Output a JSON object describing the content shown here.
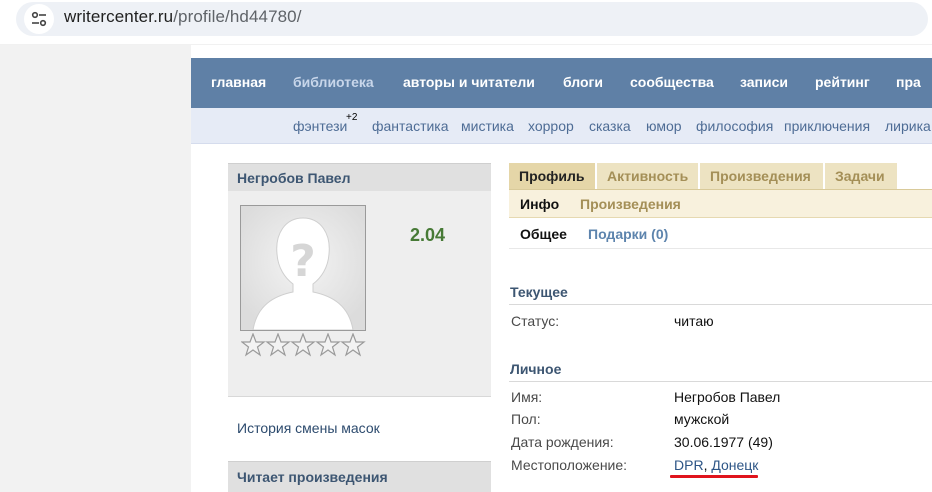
{
  "browser": {
    "url_host": "writercenter.ru",
    "url_path": "/profile/hd44780/"
  },
  "nav": {
    "items": [
      {
        "label": "главная"
      },
      {
        "label": "библиотека"
      },
      {
        "label": "авторы и читатели"
      },
      {
        "label": "блоги"
      },
      {
        "label": "сообщества"
      },
      {
        "label": "записи"
      },
      {
        "label": "рейтинг"
      },
      {
        "label": "пра"
      }
    ]
  },
  "genres": {
    "items": [
      {
        "label": "фэнтези"
      },
      {
        "label": "фантастика"
      },
      {
        "label": "мистика"
      },
      {
        "label": "хоррор"
      },
      {
        "label": "сказка"
      },
      {
        "label": "юмор"
      },
      {
        "label": "философия"
      },
      {
        "label": "приключения"
      },
      {
        "label": "лирика"
      }
    ],
    "fantasy_badge": "+2"
  },
  "profile": {
    "name": "Негробов Павел",
    "rating": "2.04",
    "stars_filled": 0,
    "stars_total": 5,
    "mask_history_link": "История смены масок",
    "reading_header": "Читает произведения"
  },
  "tabs": {
    "main": [
      {
        "label": "Профиль"
      },
      {
        "label": "Активность"
      },
      {
        "label": "Произведения"
      },
      {
        "label": "Задачи"
      }
    ],
    "sub1": [
      {
        "label": "Инфо"
      },
      {
        "label": "Произведения"
      }
    ],
    "sub2": [
      {
        "label": "Общее"
      },
      {
        "label": "Подарки (0)"
      }
    ]
  },
  "current": {
    "title": "Текущее",
    "status_label": "Статус:",
    "status_value": "читаю"
  },
  "personal": {
    "title": "Личное",
    "name_label": "Имя:",
    "name_value": "Негробов Павел",
    "gender_label": "Пол:",
    "gender_value": "мужской",
    "birth_label": "Дата рождения:",
    "birth_value": "30.06.1977 (49)",
    "location_label": "Местоположение:",
    "location_country": "DPR",
    "location_sep": ", ",
    "location_city": "Донецк"
  },
  "colors": {
    "nav_bg": "#5f80a6",
    "tab_active": "#e5d6a8",
    "rating_green": "#477a36",
    "annotation_red": "#e0141c"
  }
}
